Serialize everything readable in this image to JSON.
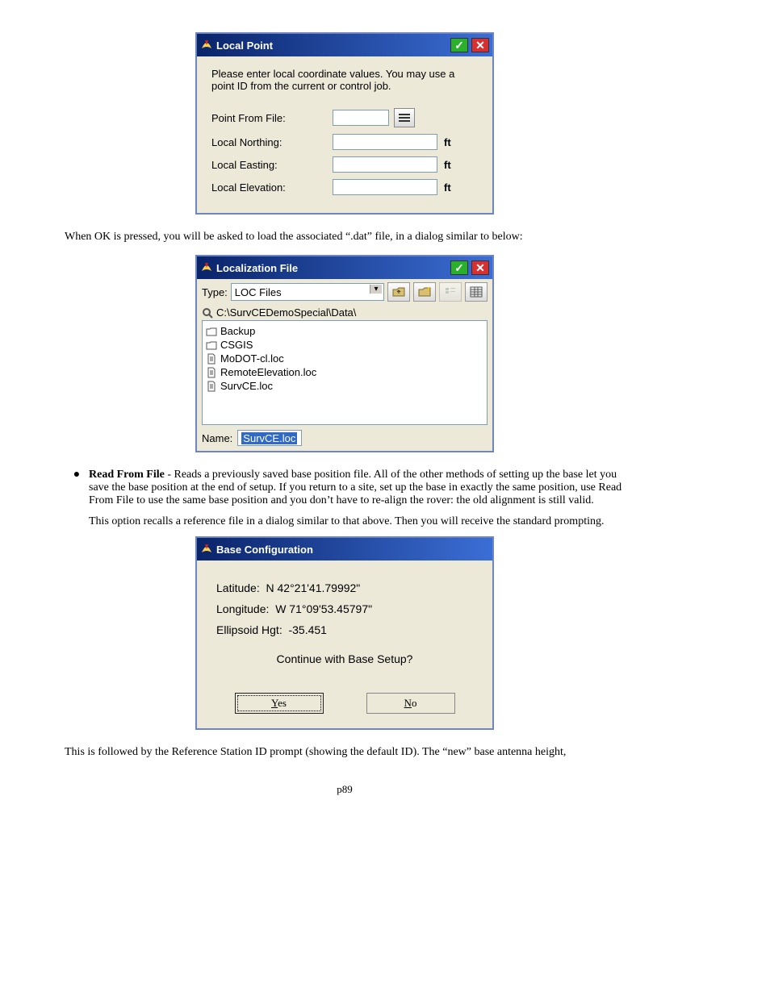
{
  "local_point": {
    "title": "Local Point",
    "instruction": "Please enter local coordinate values. You may use a point ID from the current or control job.",
    "fields": {
      "point_from_file_label": "Point From File:",
      "local_northing_label": "Local Northing:",
      "local_easting_label": "Local Easting:",
      "local_elevation_label": "Local Elevation:",
      "unit": "ft"
    }
  },
  "para1": "When OK is pressed, you will be asked to load the associated “.dat” file, in a dialog similar to below:",
  "file_dialog": {
    "title": "Localization File",
    "type_label": "Type:",
    "type_value": "LOC Files",
    "path": "C:\\SurvCEDemoSpecial\\Data\\",
    "items": [
      {
        "kind": "folder",
        "name": "Backup"
      },
      {
        "kind": "folder",
        "name": "CSGIS"
      },
      {
        "kind": "file",
        "name": "MoDOT-cl.loc"
      },
      {
        "kind": "file",
        "name": "RemoteElevation.loc"
      },
      {
        "kind": "file",
        "name": "SurvCE.loc"
      }
    ],
    "name_label": "Name:",
    "name_value": "SurvCE.loc"
  },
  "bullet": {
    "heading": "Read From File",
    "text": " - Reads a previously saved base position file. All of the other methods of setting up the base let you save the base position at the end of setup.  If you return to a site, set up the base in exactly the same position, use Read From File to use the same base position and you don’t have to re-align the rover: the old alignment is still valid."
  },
  "para2": "This option recalls a reference file in a dialog similar to that above.  Then you will receive the standard prompting.",
  "base_config": {
    "title": "Base Configuration",
    "latitude_label": "Latitude:",
    "latitude_value": "N 42°21'41.79992\"",
    "longitude_label": "Longitude:",
    "longitude_value": "W 71°09'53.45797\"",
    "ellipsoid_label": "Ellipsoid Hgt:",
    "ellipsoid_value": "-35.451",
    "prompt": "Continue with Base Setup?",
    "yes": "es",
    "no": "o"
  },
  "para3": "This is followed by the Reference Station ID prompt (showing the default ID).  The “new” base antenna height,",
  "pagenum": "p89"
}
